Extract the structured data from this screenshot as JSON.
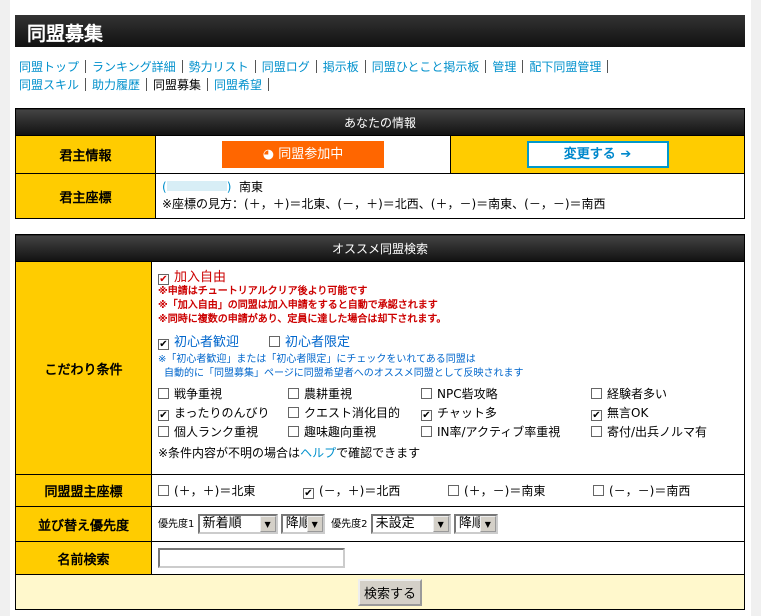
{
  "title": "同盟募集",
  "nav": [
    "同盟トップ",
    "ランキング詳細",
    "勢力リスト",
    "同盟ログ",
    "掲示板",
    "同盟ひとこと掲示板",
    "管理",
    "配下同盟管理",
    "同盟スキル",
    "助力履歴",
    "同盟募集",
    "同盟希望"
  ],
  "info": {
    "header": "あなたの情報",
    "lord_label": "君主情報",
    "join_status": "同盟参加中",
    "change_button": "変更する",
    "coord_label": "君主座標",
    "coord_dir": "南東",
    "coord_help": "※座標の見方：(＋，＋)＝北東、(－，＋)＝北西、(＋，－)＝南東、(－，－)＝南西"
  },
  "search": {
    "header": "オススメ同盟検索",
    "cond_label": "こだわり条件",
    "free_join": "加入自由",
    "notes_red": [
      "※申請はチュートリアルクリア後より可能です",
      "※「加入自由」の同盟は加入申請をすると自動で承認されます",
      "※同時に複数の申請があり、定員に達した場合は却下されます。"
    ],
    "beginner_welcome": "初心者歓迎",
    "beginner_only": "初心者限定",
    "notes_blue": [
      "※「初心者歓迎」または「初心者限定」にチェックをいれてある同盟は",
      "自動的に「同盟募集」ページに同盟希望者へのオススメ同盟として反映されます"
    ],
    "options": [
      {
        "label": "戦争重視",
        "checked": false
      },
      {
        "label": "農耕重視",
        "checked": false
      },
      {
        "label": "NPC砦攻略",
        "checked": false
      },
      {
        "label": "経験者多い",
        "checked": false
      },
      {
        "label": "まったりのんびり",
        "checked": true
      },
      {
        "label": "クエスト消化目的",
        "checked": false
      },
      {
        "label": "チャット多",
        "checked": true
      },
      {
        "label": "無言OK",
        "checked": true
      },
      {
        "label": "個人ランク重視",
        "checked": false
      },
      {
        "label": "趣味趣向重視",
        "checked": false
      },
      {
        "label": "IN率/アクティブ率重視",
        "checked": false
      },
      {
        "label": "寄付/出兵ノルマ有",
        "checked": false
      }
    ],
    "help_pre": "※条件内容が不明の場合は",
    "help_link": "ヘルプ",
    "help_post": "で確認できます",
    "coord_label": "同盟盟主座標",
    "coords": [
      {
        "label": "(＋，＋)＝北東",
        "checked": false
      },
      {
        "label": "(－，＋)＝北西",
        "checked": true
      },
      {
        "label": "(＋，－)＝南東",
        "checked": false
      },
      {
        "label": "(－，－)＝南西",
        "checked": false
      }
    ],
    "sort_label": "並び替え優先度",
    "p1_label": "優先度1",
    "p1_value": "新着順",
    "p1_order": "降順",
    "p2_label": "優先度2",
    "p2_value": "未設定",
    "p2_order": "降順",
    "name_label": "名前検索",
    "name_value": "",
    "search_button": "検索する"
  }
}
